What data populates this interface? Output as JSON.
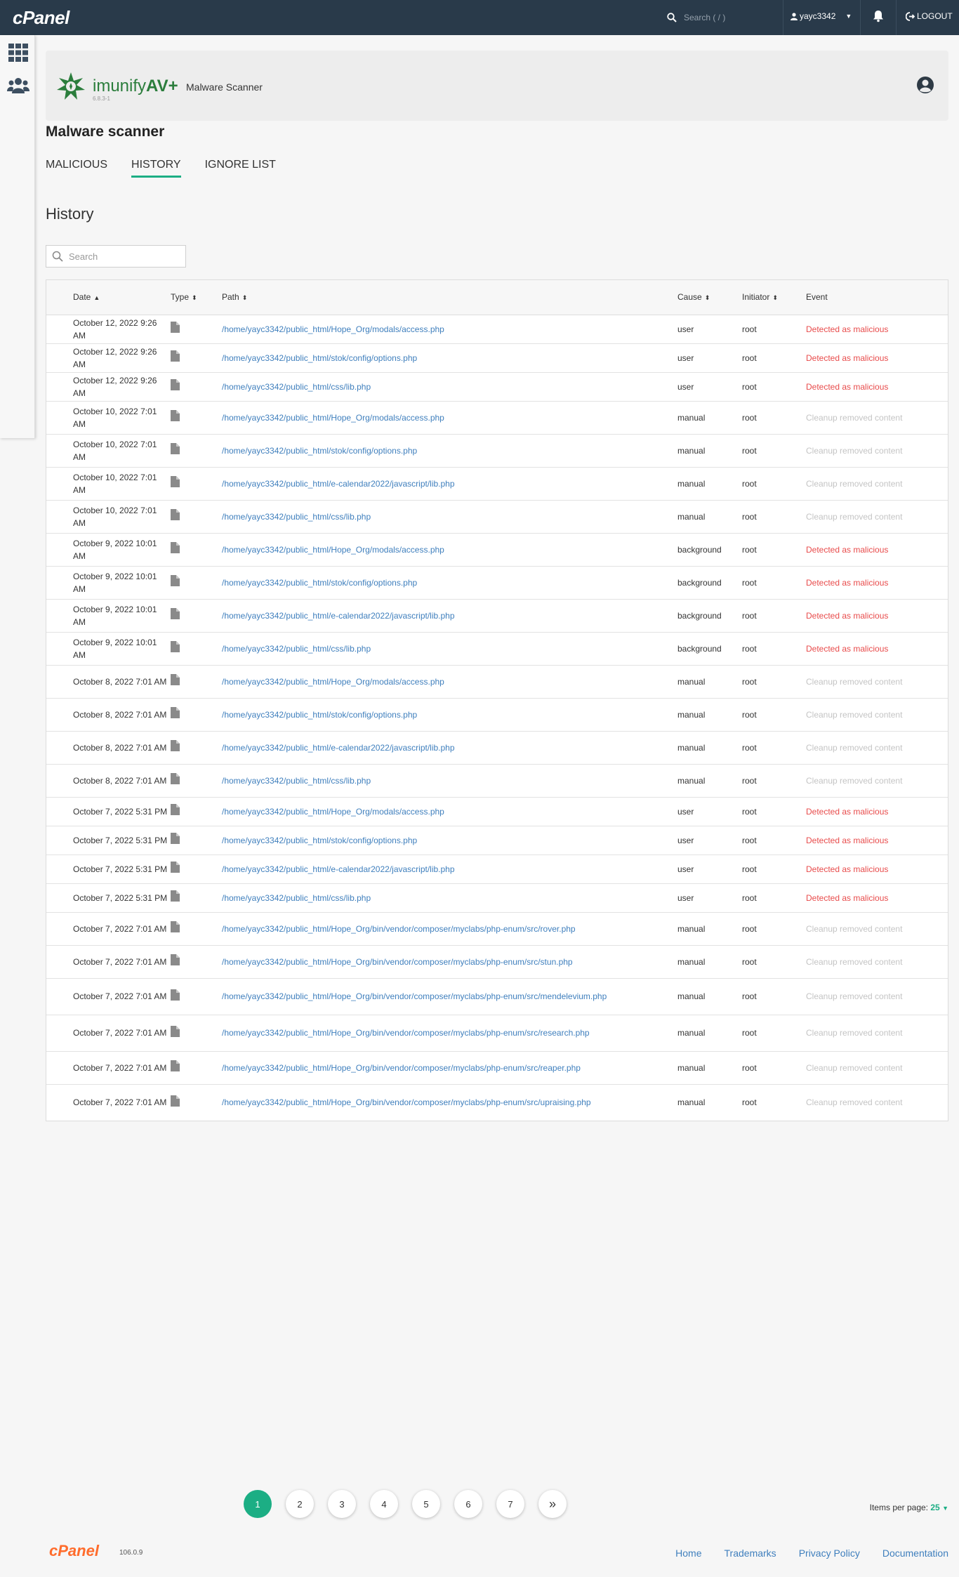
{
  "topbar": {
    "logo": "cPanel",
    "search_placeholder": "Search ( / )",
    "username": "yayc3342",
    "logout": "LOGOUT"
  },
  "plugin": {
    "brand_light": "imunify",
    "brand_bold": "AV+",
    "version": "6.8.3-1",
    "title": "Malware Scanner"
  },
  "page": {
    "title": "Malware scanner",
    "tabs": [
      "MALICIOUS",
      "HISTORY",
      "IGNORE LIST"
    ],
    "active_tab": "HISTORY",
    "section_title": "History",
    "search_placeholder": "Search"
  },
  "table": {
    "headers": {
      "date": "Date",
      "type": "Type",
      "path": "Path",
      "cause": "Cause",
      "initiator": "Initiator",
      "event": "Event"
    },
    "rows": [
      {
        "date": "October 12, 2022 9:26 AM",
        "path": "/home/yayc3342/public_html/Hope_Org/modals/access.php",
        "cause": "user",
        "initiator": "root",
        "event": "Detected as malicious",
        "event_type": "malicious",
        "h": 41
      },
      {
        "date": "October 12, 2022 9:26 AM",
        "path": "/home/yayc3342/public_html/stok/config/options.php",
        "cause": "user",
        "initiator": "root",
        "event": "Detected as malicious",
        "event_type": "malicious",
        "h": 41
      },
      {
        "date": "October 12, 2022 9:26 AM",
        "path": "/home/yayc3342/public_html/css/lib.php",
        "cause": "user",
        "initiator": "root",
        "event": "Detected as malicious",
        "event_type": "malicious",
        "h": 41
      },
      {
        "date": "October 10, 2022 7:01 AM",
        "path": "/home/yayc3342/public_html/Hope_Org/modals/access.php",
        "cause": "manual",
        "initiator": "root",
        "event": "Cleanup removed content",
        "event_type": "cleanup",
        "h": 47
      },
      {
        "date": "October 10, 2022 7:01 AM",
        "path": "/home/yayc3342/public_html/stok/config/options.php",
        "cause": "manual",
        "initiator": "root",
        "event": "Cleanup removed content",
        "event_type": "cleanup",
        "h": 47
      },
      {
        "date": "October 10, 2022 7:01 AM",
        "path": "/home/yayc3342/public_html/e-calendar2022/javascript/lib.php",
        "cause": "manual",
        "initiator": "root",
        "event": "Cleanup removed content",
        "event_type": "cleanup",
        "h": 47
      },
      {
        "date": "October 10, 2022 7:01 AM",
        "path": "/home/yayc3342/public_html/css/lib.php",
        "cause": "manual",
        "initiator": "root",
        "event": "Cleanup removed content",
        "event_type": "cleanup",
        "h": 47
      },
      {
        "date": "October 9, 2022 10:01 AM",
        "path": "/home/yayc3342/public_html/Hope_Org/modals/access.php",
        "cause": "background",
        "initiator": "root",
        "event": "Detected as malicious",
        "event_type": "malicious",
        "h": 47
      },
      {
        "date": "October 9, 2022 10:01 AM",
        "path": "/home/yayc3342/public_html/stok/config/options.php",
        "cause": "background",
        "initiator": "root",
        "event": "Detected as malicious",
        "event_type": "malicious",
        "h": 47
      },
      {
        "date": "October 9, 2022 10:01 AM",
        "path": "/home/yayc3342/public_html/e-calendar2022/javascript/lib.php",
        "cause": "background",
        "initiator": "root",
        "event": "Detected as malicious",
        "event_type": "malicious",
        "h": 47
      },
      {
        "date": "October 9, 2022 10:01 AM",
        "path": "/home/yayc3342/public_html/css/lib.php",
        "cause": "background",
        "initiator": "root",
        "event": "Detected as malicious",
        "event_type": "malicious",
        "h": 47
      },
      {
        "date": "October 8, 2022 7:01 AM",
        "path": "/home/yayc3342/public_html/Hope_Org/modals/access.php",
        "cause": "manual",
        "initiator": "root",
        "event": "Cleanup removed content",
        "event_type": "cleanup",
        "h": 47
      },
      {
        "date": "October 8, 2022 7:01 AM",
        "path": "/home/yayc3342/public_html/stok/config/options.php",
        "cause": "manual",
        "initiator": "root",
        "event": "Cleanup removed content",
        "event_type": "cleanup",
        "h": 47
      },
      {
        "date": "October 8, 2022 7:01 AM",
        "path": "/home/yayc3342/public_html/e-calendar2022/javascript/lib.php",
        "cause": "manual",
        "initiator": "root",
        "event": "Cleanup removed content",
        "event_type": "cleanup",
        "h": 47
      },
      {
        "date": "October 8, 2022 7:01 AM",
        "path": "/home/yayc3342/public_html/css/lib.php",
        "cause": "manual",
        "initiator": "root",
        "event": "Cleanup removed content",
        "event_type": "cleanup",
        "h": 47
      },
      {
        "date": "October 7, 2022 5:31 PM",
        "path": "/home/yayc3342/public_html/Hope_Org/modals/access.php",
        "cause": "user",
        "initiator": "root",
        "event": "Detected as malicious",
        "event_type": "malicious",
        "h": 41
      },
      {
        "date": "October 7, 2022 5:31 PM",
        "path": "/home/yayc3342/public_html/stok/config/options.php",
        "cause": "user",
        "initiator": "root",
        "event": "Detected as malicious",
        "event_type": "malicious",
        "h": 41
      },
      {
        "date": "October 7, 2022 5:31 PM",
        "path": "/home/yayc3342/public_html/e-calendar2022/javascript/lib.php",
        "cause": "user",
        "initiator": "root",
        "event": "Detected as malicious",
        "event_type": "malicious",
        "h": 41
      },
      {
        "date": "October 7, 2022 5:31 PM",
        "path": "/home/yayc3342/public_html/css/lib.php",
        "cause": "user",
        "initiator": "root",
        "event": "Detected as malicious",
        "event_type": "malicious",
        "h": 41
      },
      {
        "date": "October 7, 2022 7:01 AM",
        "path": "/home/yayc3342/public_html/Hope_Org/bin/vendor/composer/myclabs/php-enum/src/rover.php",
        "cause": "manual",
        "initiator": "root",
        "event": "Cleanup removed content",
        "event_type": "cleanup",
        "h": 47
      },
      {
        "date": "October 7, 2022 7:01 AM",
        "path": "/home/yayc3342/public_html/Hope_Org/bin/vendor/composer/myclabs/php-enum/src/stun.php",
        "cause": "manual",
        "initiator": "root",
        "event": "Cleanup removed content",
        "event_type": "cleanup",
        "h": 47
      },
      {
        "date": "October 7, 2022 7:01 AM",
        "path": "/home/yayc3342/public_html/Hope_Org/bin/vendor/composer/myclabs/php-enum/src/mendelevium.php",
        "cause": "manual",
        "initiator": "root",
        "event": "Cleanup removed content",
        "event_type": "cleanup",
        "h": 52
      },
      {
        "date": "October 7, 2022 7:01 AM",
        "path": "/home/yayc3342/public_html/Hope_Org/bin/vendor/composer/myclabs/php-enum/src/research.php",
        "cause": "manual",
        "initiator": "root",
        "event": "Cleanup removed content",
        "event_type": "cleanup",
        "h": 52
      },
      {
        "date": "October 7, 2022 7:01 AM",
        "path": "/home/yayc3342/public_html/Hope_Org/bin/vendor/composer/myclabs/php-enum/src/reaper.php",
        "cause": "manual",
        "initiator": "root",
        "event": "Cleanup removed content",
        "event_type": "cleanup",
        "h": 47
      },
      {
        "date": "October 7, 2022 7:01 AM",
        "path": "/home/yayc3342/public_html/Hope_Org/bin/vendor/composer/myclabs/php-enum/src/upraising.php",
        "cause": "manual",
        "initiator": "root",
        "event": "Cleanup removed content",
        "event_type": "cleanup",
        "h": 52
      }
    ]
  },
  "pagination": {
    "pages": [
      "1",
      "2",
      "3",
      "4",
      "5",
      "6",
      "7"
    ],
    "current": "1",
    "next_label": "»",
    "items_per_page_label": "Items per page:",
    "items_per_page_value": "25"
  },
  "footer": {
    "logo": "cPanel",
    "version": "106.0.9",
    "links": [
      "Home",
      "Trademarks",
      "Privacy Policy",
      "Documentation"
    ]
  },
  "colors": {
    "accent": "#1cae84",
    "topbar": "#293a4a",
    "malicious": "#e84b4b",
    "cleanup": "#c4c4c4",
    "link": "#3f7fbd",
    "brand_green": "#2b7d3c",
    "cpanel_orange": "#ff6c2c"
  }
}
